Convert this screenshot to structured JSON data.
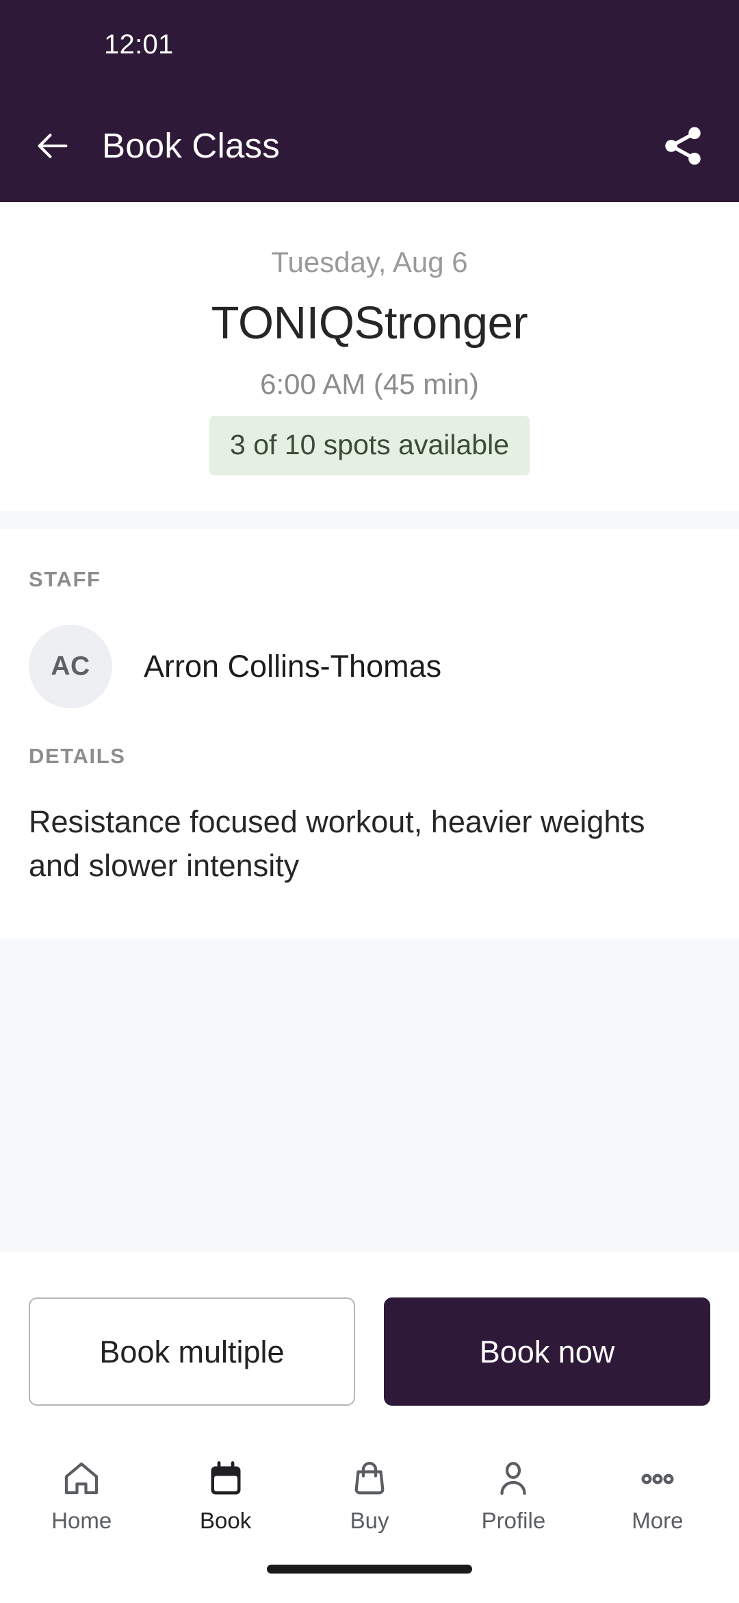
{
  "status_bar": {
    "time": "12:01"
  },
  "app_bar": {
    "title": "Book Class",
    "back_icon": "arrow-left-icon",
    "share_icon": "share-icon"
  },
  "class": {
    "date": "Tuesday, Aug 6",
    "name": "TONIQStronger",
    "time": "6:00 AM (45 min)",
    "spots_badge": "3 of 10 spots available",
    "spots_available": 3,
    "spots_total": 10
  },
  "staff_section": {
    "label": "STAFF",
    "members": [
      {
        "initials": "AC",
        "name": "Arron Collins-Thomas"
      }
    ]
  },
  "details_section": {
    "label": "DETAILS",
    "text": "Resistance focused workout, heavier weights and slower intensity"
  },
  "actions": {
    "secondary_label": "Book multiple",
    "primary_label": "Book now"
  },
  "bottom_nav": {
    "items": [
      {
        "label": "Home",
        "icon": "home-icon",
        "active": false
      },
      {
        "label": "Book",
        "icon": "calendar-icon",
        "active": true
      },
      {
        "label": "Buy",
        "icon": "shopping-bag-icon",
        "active": false
      },
      {
        "label": "Profile",
        "icon": "person-icon",
        "active": false
      },
      {
        "label": "More",
        "icon": "ellipsis-icon",
        "active": false
      }
    ]
  },
  "colors": {
    "brand_purple": "#2E1A38",
    "badge_green_bg": "#E4F0E2",
    "badge_green_text": "#3D4B3A",
    "surface_grey": "#F6F8FA",
    "muted_text": "#8d8d8d"
  }
}
